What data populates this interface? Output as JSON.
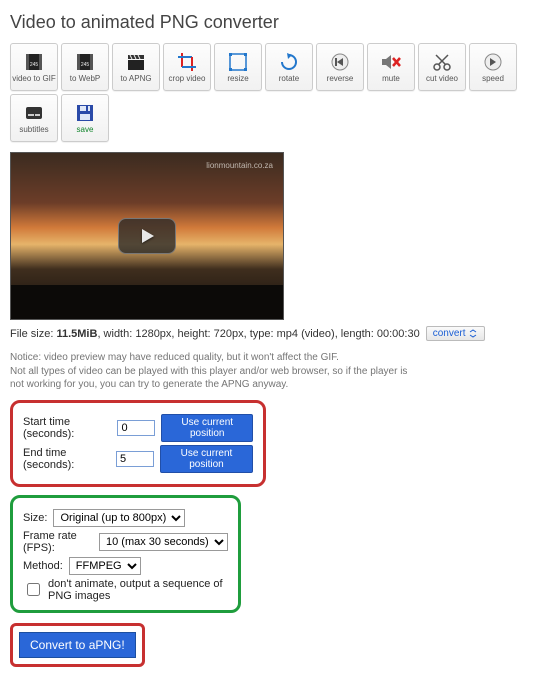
{
  "title": "Video to animated PNG converter",
  "toolbar": [
    {
      "name": "video-to-gif",
      "label": "video to GIF"
    },
    {
      "name": "to-webp",
      "label": "to WebP"
    },
    {
      "name": "to-apng",
      "label": "to APNG"
    },
    {
      "name": "crop-video",
      "label": "crop video"
    },
    {
      "name": "resize",
      "label": "resize"
    },
    {
      "name": "rotate",
      "label": "rotate"
    },
    {
      "name": "reverse",
      "label": "reverse"
    },
    {
      "name": "mute",
      "label": "mute"
    },
    {
      "name": "cut-video",
      "label": "cut video"
    },
    {
      "name": "speed",
      "label": "speed"
    },
    {
      "name": "subtitles",
      "label": "subtitles"
    },
    {
      "name": "save",
      "label": "save"
    }
  ],
  "watermark": "lionmountain.co.za",
  "meta": {
    "prefix": "File size: ",
    "size": "11.5MiB",
    "rest": ", width: 1280px, height: 720px, type: mp4 (video), length: 00:00:30",
    "convert_link": "convert"
  },
  "notice": "Notice: video preview may have reduced quality, but it won't affect the GIF.\nNot all types of video can be played with this player and/or web browser, so if the player is not working for you, you can try to generate the APNG anyway.",
  "time": {
    "start_label": "Start time (seconds):",
    "start_value": "0",
    "end_label": "End time (seconds):",
    "end_value": "5",
    "use_pos": "Use current position"
  },
  "opts": {
    "size_label": "Size:",
    "size_value": "Original (up to 800px)",
    "fps_label": "Frame rate (FPS):",
    "fps_value": "10 (max 30 seconds)",
    "method_label": "Method:",
    "method_value": "FFMPEG",
    "seq_label": "don't animate, output a sequence of PNG images"
  },
  "go": "Convert to aPNG!"
}
